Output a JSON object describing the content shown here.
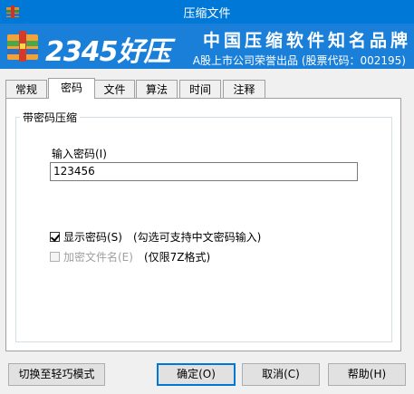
{
  "window": {
    "title": "压缩文件"
  },
  "banner": {
    "brand": "2345好压",
    "slogan": "中国压缩软件知名品牌",
    "listed": "A股上市公司荣誉出品 (股票代码：002195)"
  },
  "tabs": [
    "常规",
    "密码",
    "文件",
    "算法",
    "时间",
    "注释"
  ],
  "active_tab": "密码",
  "password": {
    "group_title": "带密码压缩",
    "input_label": "输入密码(I)",
    "input_value": "123456",
    "show_password": {
      "label": "显示密码(S)",
      "hint": "(勾选可支持中文密码输入)",
      "checked": true
    },
    "encrypt_names": {
      "label": "加密文件名(E)",
      "hint": "(仅限7Z格式)",
      "checked": false,
      "disabled": true
    }
  },
  "buttons": {
    "light_mode": "切换至轻巧模式",
    "ok": "确定(O)",
    "cancel": "取消(C)",
    "help": "帮助(H)"
  },
  "colors": {
    "titlebar": "#0078d7",
    "banner": "#1a7fd9"
  },
  "icons": {
    "app": "archive-icon",
    "logo": "archive-logo-icon"
  }
}
